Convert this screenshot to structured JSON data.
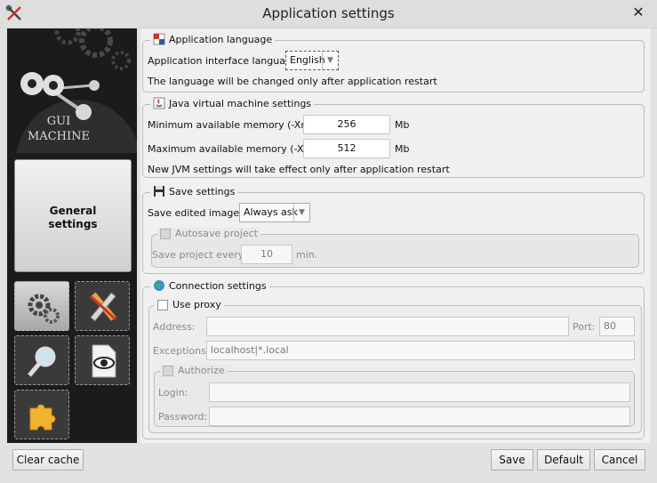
{
  "window": {
    "title": "Application settings",
    "close_symbol": "✕"
  },
  "sidebar": {
    "logo_line1": "GUI",
    "logo_line2": "MACHINE",
    "active_tile_label_1": "General",
    "active_tile_label_2": "settings",
    "tiles": [
      "gears-icon",
      "pencil-ruler-icon",
      "magnifier-icon",
      "eye-document-icon",
      "puzzle-icon"
    ]
  },
  "language": {
    "legend": "Application language",
    "label": "Application interface language:",
    "value": "English",
    "note": "The language will be changed only after application restart"
  },
  "jvm": {
    "legend": "Java virtual machine settings",
    "min_label": "Minimum available memory (-Xms):",
    "min_value": "256",
    "max_label": "Maximum available memory (-Xmx):",
    "max_value": "512",
    "unit": "Mb",
    "note": "New JVM settings will take effect only after application restart"
  },
  "save": {
    "legend": "Save settings",
    "label": "Save edited images:",
    "value": "Always ask",
    "autosave_label": "Autosave project",
    "every_label": "Save project every:",
    "every_value": "10",
    "every_unit": "min."
  },
  "connection": {
    "legend": "Connection settings",
    "use_proxy_label": "Use proxy",
    "address_label": "Address:",
    "address_value": "",
    "port_label": "Port:",
    "port_value": "80",
    "exceptions_label": "Exceptions:",
    "exceptions_value": "localhost|*.local",
    "authorize_label": "Authorize",
    "login_label": "Login:",
    "login_value": "",
    "password_label": "Password:",
    "password_value": ""
  },
  "buttons": {
    "clear_cache": "Clear cache",
    "save": "Save",
    "default": "Default",
    "cancel": "Cancel"
  },
  "colors": {
    "sidebar_bg": "#1b1b1b",
    "panel_bg": "#f0f0f0",
    "window_bg": "#e2e2e2"
  }
}
